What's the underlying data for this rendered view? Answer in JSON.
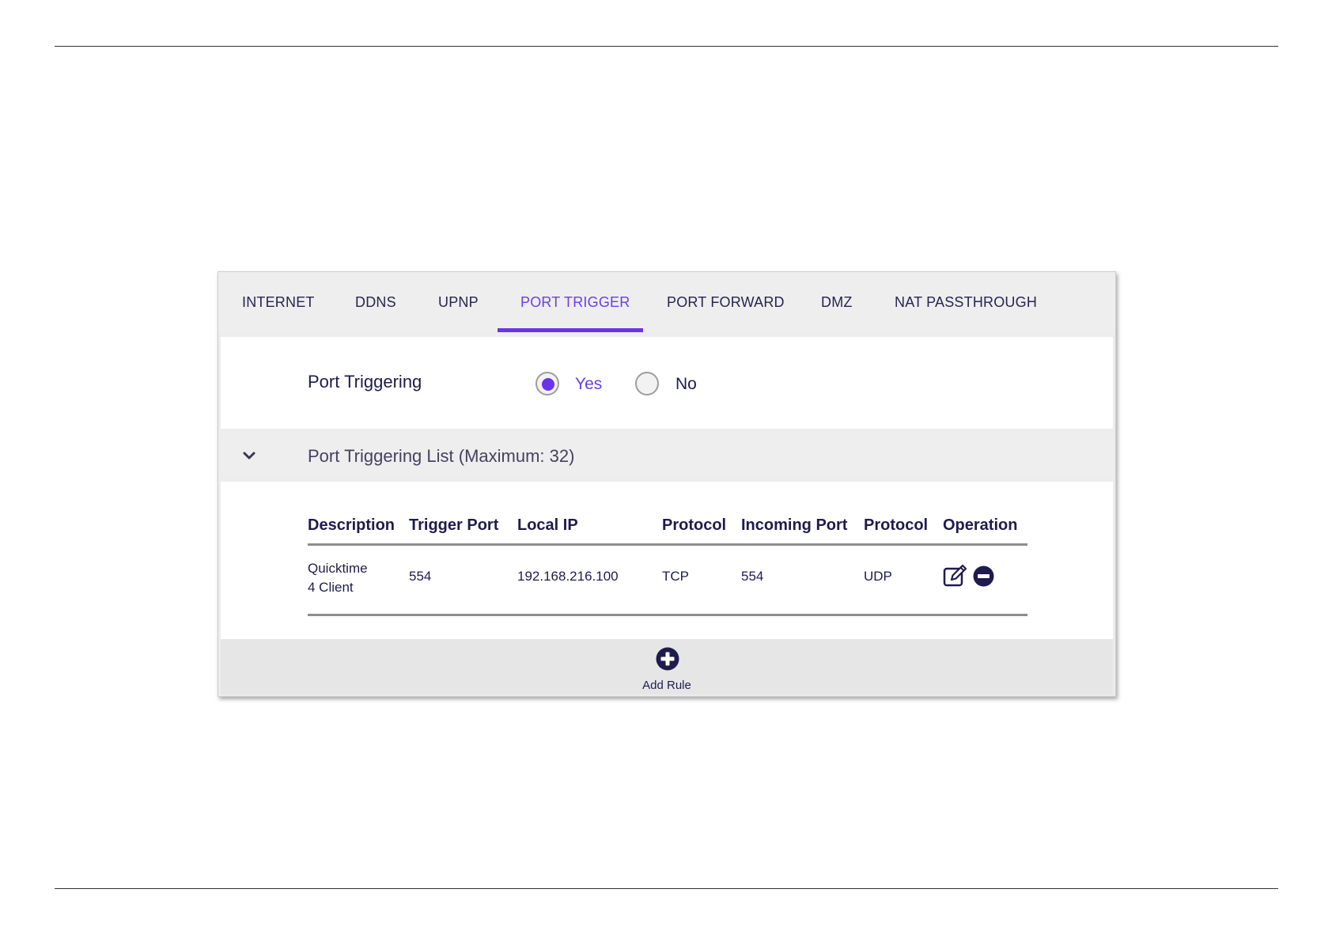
{
  "tabs": [
    {
      "label": "INTERNET"
    },
    {
      "label": "DDNS"
    },
    {
      "label": "UPNP"
    },
    {
      "label": "PORT TRIGGER",
      "active": true
    },
    {
      "label": "PORT FORWARD"
    },
    {
      "label": "DMZ"
    },
    {
      "label": "NAT PASSTHROUGH"
    }
  ],
  "toggle": {
    "label": "Port Triggering",
    "options": [
      {
        "label": "Yes",
        "selected": true
      },
      {
        "label": "No",
        "selected": false
      }
    ]
  },
  "list": {
    "title": "Port Triggering List (Maximum: 32)",
    "columns": [
      "Description",
      "Trigger Port",
      "Local IP",
      "Protocol",
      "Incoming Port",
      "Protocol",
      "Operation"
    ],
    "rows": [
      {
        "description_line1": "Quicktime",
        "description_line2": "4 Client",
        "trigger_port": "554",
        "local_ip": "192.168.216.100",
        "trigger_protocol": "TCP",
        "incoming_port": "554",
        "incoming_protocol": "UDP",
        "operations": [
          "edit-icon",
          "remove-icon"
        ]
      }
    ]
  },
  "footer": {
    "add_rule_label": "Add Rule",
    "add_icon": "plus-circle-icon"
  },
  "colors": {
    "accent": "#6a34ea",
    "dark": "#1f1b4d"
  }
}
